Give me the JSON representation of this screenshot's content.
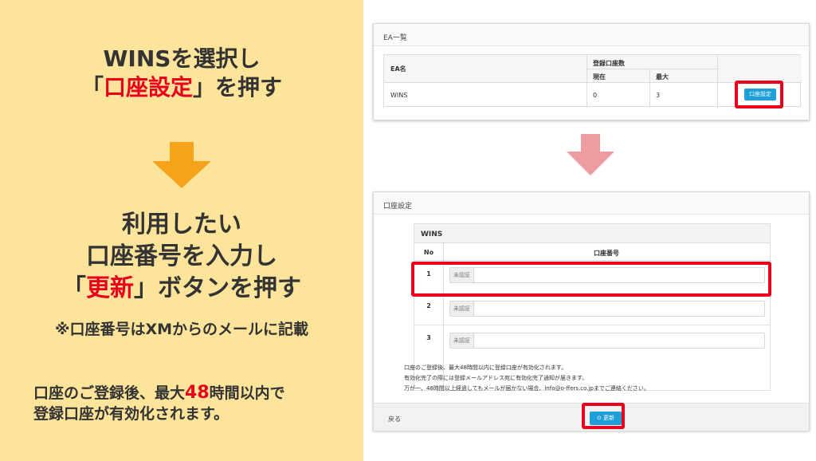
{
  "left_panel": {
    "step1_line1": "WINSを選択し",
    "step1_line2_open": "「",
    "step1_line2_red": "口座設定",
    "step1_line2_close": "」を押す",
    "step2_line1": "利用したい",
    "step2_line2": "口座番号を入力し",
    "step2_line3_open": "「",
    "step2_line3_red": "更新",
    "step2_line3_close": "」ボタンを押す",
    "note": "※口座番号はXMからのメールに記載",
    "bottom_line1_pre": "口座のご登録後、最大",
    "bottom_line1_num": "48",
    "bottom_line1_post": "時間以内で",
    "bottom_line2": "登録口座が有効化されます。"
  },
  "ea_card": {
    "title": "EA一覧",
    "col_name": "EA名",
    "col_count": "登録口座数",
    "col_current": "現在",
    "col_max": "最大",
    "row": {
      "name": "WINS",
      "current": "0",
      "max": "3",
      "button": "口座設定"
    }
  },
  "account_card": {
    "title": "口座設定",
    "ea_name": "WINS",
    "col_no": "No",
    "col_account": "口座番号",
    "rows": [
      {
        "no": "1",
        "status": "未認証",
        "value": ""
      },
      {
        "no": "2",
        "status": "未認証",
        "value": ""
      },
      {
        "no": "3",
        "status": "未認証",
        "value": ""
      }
    ],
    "info_line1": "口座のご登録後、最大48時間以内に登録口座が有効化されます。",
    "info_line2": "有効化完了の際には登録メールアドレス宛に有効化完了通知が届きます。",
    "info_line3": "万が一、48時間以上経過してもメールが届かない場合、info@o-ffers.co.jpまでご連絡ください。",
    "back": "戻る",
    "update": "更新"
  },
  "colors": {
    "left_bg": "#fde49b",
    "highlight_red": "#e8001c",
    "arrow_orange": "#f7a21b",
    "arrow_pink": "#ef9ca0",
    "button_blue": "#1e9fd8"
  }
}
